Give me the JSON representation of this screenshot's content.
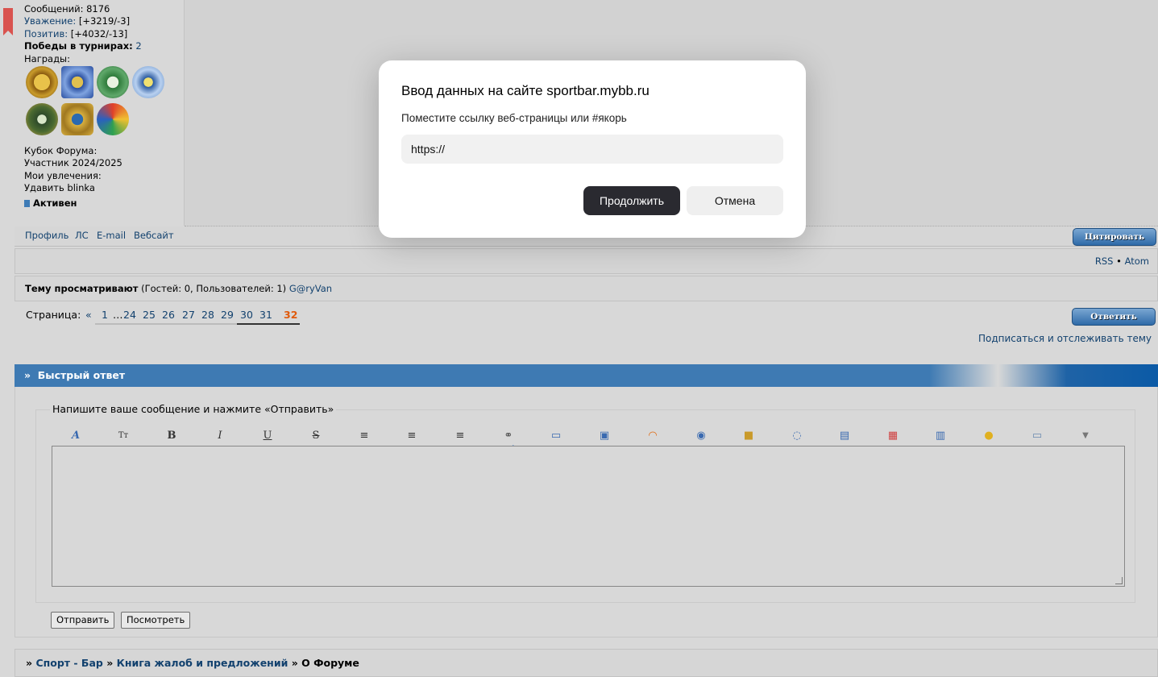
{
  "profile": {
    "messages": "Сообщений: 8176",
    "respect_label": "Уважение:",
    "respect_value": " [+3219/-3]",
    "positive_label": "Позитив:",
    "positive_value": " [+4032/-13]",
    "wins_label": "Победы в турнирах:",
    "wins_value": " 2",
    "awards_label": "Награды:",
    "cup_label": "Кубок Форума:",
    "cup_value": "Участник 2024/2025",
    "hobbies_label": "Мои увлечения:",
    "hobbies_value": "Удавить blinka",
    "status": "Активен"
  },
  "post_links": [
    "Профиль",
    "ЛС",
    "E-mail",
    "Вебсайт"
  ],
  "quote_button": "Цитировать",
  "reply_button": "Ответить",
  "feeds": {
    "rss": "RSS",
    "sep": " • ",
    "atom": "Atom"
  },
  "viewers": {
    "label": "Тему просматривают",
    "counts": " (Гостей: 0, Пользователей: 1) ",
    "user": "G@ryVan"
  },
  "pager": {
    "label": "Страница:",
    "prev": "«",
    "pages": [
      "1",
      "…",
      "24",
      "25",
      "26",
      "27",
      "28",
      "29",
      "30",
      "31"
    ],
    "current": "32"
  },
  "subscribe": "Подписаться и отслеживать тему",
  "quick_reply": {
    "title": "Быстрый ответ",
    "legend": "Напишите ваше сообщение и нажмите «Отправить»",
    "submit": "Отправить",
    "preview": "Посмотреть"
  },
  "breadcrumb": {
    "items": [
      "Спорт - Бар",
      "Книга жалоб и предложений"
    ],
    "current": "О Форуме"
  },
  "modal": {
    "title": "Ввод данных на сайте sportbar.mybb.ru",
    "subtitle": "Поместите ссылку веб-страницы или #якорь",
    "input_value": "https://",
    "ok": "Продолжить",
    "cancel": "Отмена"
  },
  "colors": {
    "header_blue": "#3e7ab3",
    "link": "#12416e",
    "current_page": "#e05a0c"
  }
}
